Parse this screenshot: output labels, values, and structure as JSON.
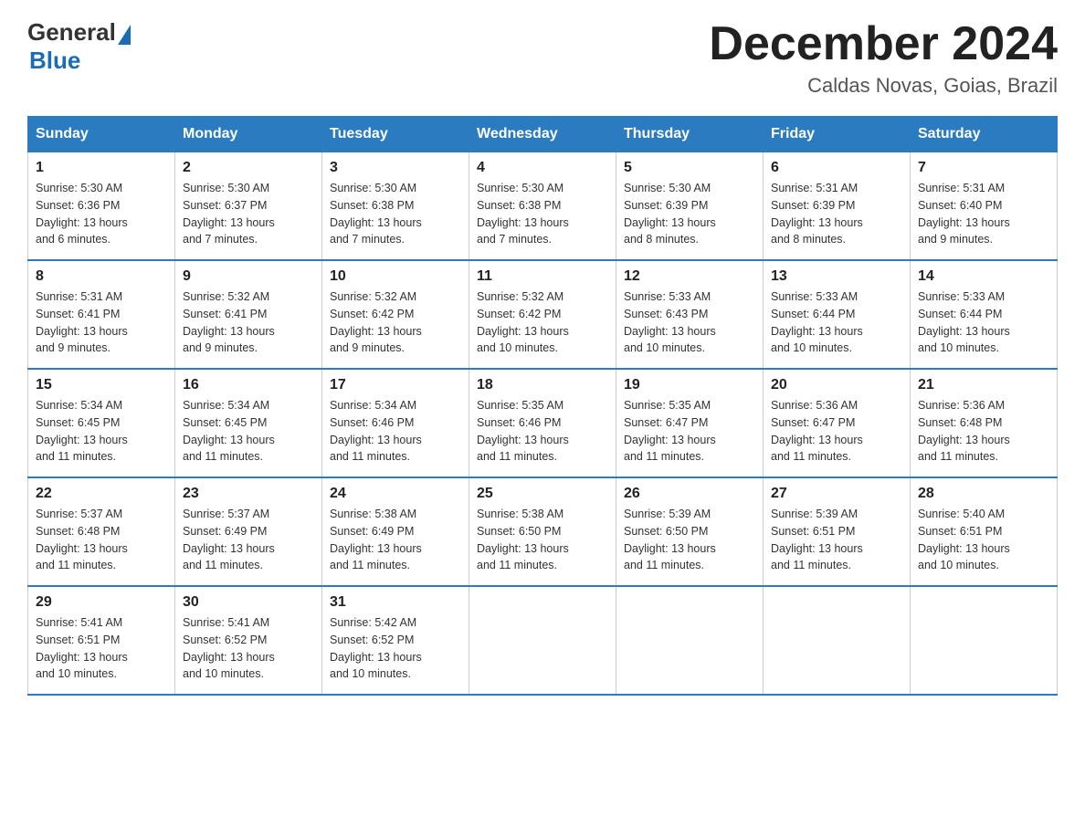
{
  "logo": {
    "general": "General",
    "blue": "Blue"
  },
  "title": "December 2024",
  "subtitle": "Caldas Novas, Goias, Brazil",
  "days_of_week": [
    "Sunday",
    "Monday",
    "Tuesday",
    "Wednesday",
    "Thursday",
    "Friday",
    "Saturday"
  ],
  "weeks": [
    [
      {
        "day": "1",
        "sunrise": "5:30 AM",
        "sunset": "6:36 PM",
        "daylight": "13 hours and 6 minutes."
      },
      {
        "day": "2",
        "sunrise": "5:30 AM",
        "sunset": "6:37 PM",
        "daylight": "13 hours and 7 minutes."
      },
      {
        "day": "3",
        "sunrise": "5:30 AM",
        "sunset": "6:38 PM",
        "daylight": "13 hours and 7 minutes."
      },
      {
        "day": "4",
        "sunrise": "5:30 AM",
        "sunset": "6:38 PM",
        "daylight": "13 hours and 7 minutes."
      },
      {
        "day": "5",
        "sunrise": "5:30 AM",
        "sunset": "6:39 PM",
        "daylight": "13 hours and 8 minutes."
      },
      {
        "day": "6",
        "sunrise": "5:31 AM",
        "sunset": "6:39 PM",
        "daylight": "13 hours and 8 minutes."
      },
      {
        "day": "7",
        "sunrise": "5:31 AM",
        "sunset": "6:40 PM",
        "daylight": "13 hours and 9 minutes."
      }
    ],
    [
      {
        "day": "8",
        "sunrise": "5:31 AM",
        "sunset": "6:41 PM",
        "daylight": "13 hours and 9 minutes."
      },
      {
        "day": "9",
        "sunrise": "5:32 AM",
        "sunset": "6:41 PM",
        "daylight": "13 hours and 9 minutes."
      },
      {
        "day": "10",
        "sunrise": "5:32 AM",
        "sunset": "6:42 PM",
        "daylight": "13 hours and 9 minutes."
      },
      {
        "day": "11",
        "sunrise": "5:32 AM",
        "sunset": "6:42 PM",
        "daylight": "13 hours and 10 minutes."
      },
      {
        "day": "12",
        "sunrise": "5:33 AM",
        "sunset": "6:43 PM",
        "daylight": "13 hours and 10 minutes."
      },
      {
        "day": "13",
        "sunrise": "5:33 AM",
        "sunset": "6:44 PM",
        "daylight": "13 hours and 10 minutes."
      },
      {
        "day": "14",
        "sunrise": "5:33 AM",
        "sunset": "6:44 PM",
        "daylight": "13 hours and 10 minutes."
      }
    ],
    [
      {
        "day": "15",
        "sunrise": "5:34 AM",
        "sunset": "6:45 PM",
        "daylight": "13 hours and 11 minutes."
      },
      {
        "day": "16",
        "sunrise": "5:34 AM",
        "sunset": "6:45 PM",
        "daylight": "13 hours and 11 minutes."
      },
      {
        "day": "17",
        "sunrise": "5:34 AM",
        "sunset": "6:46 PM",
        "daylight": "13 hours and 11 minutes."
      },
      {
        "day": "18",
        "sunrise": "5:35 AM",
        "sunset": "6:46 PM",
        "daylight": "13 hours and 11 minutes."
      },
      {
        "day": "19",
        "sunrise": "5:35 AM",
        "sunset": "6:47 PM",
        "daylight": "13 hours and 11 minutes."
      },
      {
        "day": "20",
        "sunrise": "5:36 AM",
        "sunset": "6:47 PM",
        "daylight": "13 hours and 11 minutes."
      },
      {
        "day": "21",
        "sunrise": "5:36 AM",
        "sunset": "6:48 PM",
        "daylight": "13 hours and 11 minutes."
      }
    ],
    [
      {
        "day": "22",
        "sunrise": "5:37 AM",
        "sunset": "6:48 PM",
        "daylight": "13 hours and 11 minutes."
      },
      {
        "day": "23",
        "sunrise": "5:37 AM",
        "sunset": "6:49 PM",
        "daylight": "13 hours and 11 minutes."
      },
      {
        "day": "24",
        "sunrise": "5:38 AM",
        "sunset": "6:49 PM",
        "daylight": "13 hours and 11 minutes."
      },
      {
        "day": "25",
        "sunrise": "5:38 AM",
        "sunset": "6:50 PM",
        "daylight": "13 hours and 11 minutes."
      },
      {
        "day": "26",
        "sunrise": "5:39 AM",
        "sunset": "6:50 PM",
        "daylight": "13 hours and 11 minutes."
      },
      {
        "day": "27",
        "sunrise": "5:39 AM",
        "sunset": "6:51 PM",
        "daylight": "13 hours and 11 minutes."
      },
      {
        "day": "28",
        "sunrise": "5:40 AM",
        "sunset": "6:51 PM",
        "daylight": "13 hours and 10 minutes."
      }
    ],
    [
      {
        "day": "29",
        "sunrise": "5:41 AM",
        "sunset": "6:51 PM",
        "daylight": "13 hours and 10 minutes."
      },
      {
        "day": "30",
        "sunrise": "5:41 AM",
        "sunset": "6:52 PM",
        "daylight": "13 hours and 10 minutes."
      },
      {
        "day": "31",
        "sunrise": "5:42 AM",
        "sunset": "6:52 PM",
        "daylight": "13 hours and 10 minutes."
      },
      null,
      null,
      null,
      null
    ]
  ],
  "labels": {
    "sunrise": "Sunrise:",
    "sunset": "Sunset:",
    "daylight": "Daylight:"
  }
}
